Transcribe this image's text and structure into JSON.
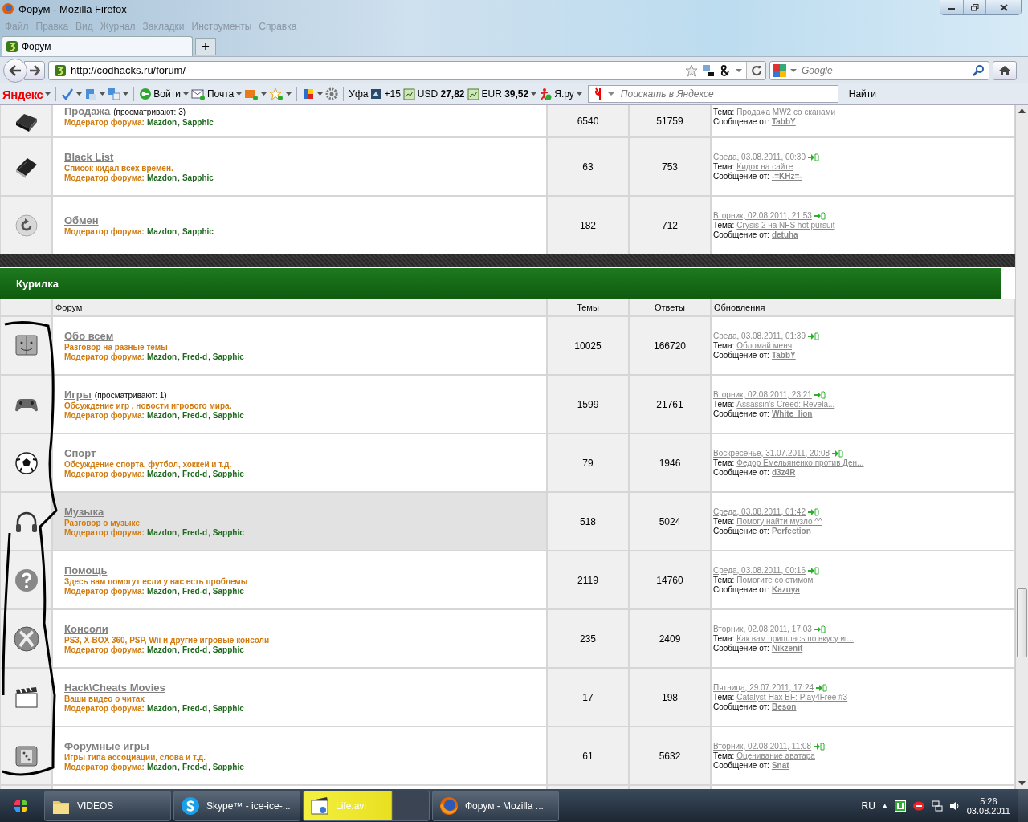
{
  "window": {
    "title": "Форум - Mozilla Firefox"
  },
  "menu": [
    "Файл",
    "Правка",
    "Вид",
    "Журнал",
    "Закладки",
    "Инструменты",
    "Справка"
  ],
  "tabs": [
    {
      "label": "Форум",
      "selected": true
    }
  ],
  "new_tab": "+",
  "address_bar": {
    "url": "http://codhacks.ru/forum/"
  },
  "search_bar": {
    "placeholder": "Google"
  },
  "yandex_toolbar": {
    "logo": "Яндекс",
    "login": "Войти",
    "mail": "Почта",
    "city": "Уфа",
    "temperature": "+15",
    "usd": "USD **27,82**",
    "eur": "EUR **39,52**",
    "yaru": "Я.ру",
    "search": {
      "placeholder": "Поискать в Яндексе"
    },
    "find_button": "Найти"
  },
  "upper_forums": [
    {
      "title": "Продажа",
      "viewers": "(просматривают: 3)",
      "moderator_label": "Модератор форума:",
      "moderators": [
        "Mazdon",
        "Sapphic"
      ],
      "separator": ",",
      "topics": "6540",
      "replies": "51759",
      "last": {
        "topic_label": "Тема:",
        "topic": "Продажа MW2 со сканами",
        "author_label": "Сообщение от:",
        "author": "TabbY"
      },
      "highlighted": false
    },
    {
      "title": "Black List",
      "description": "Список кидал всех времен.",
      "moderator_label": "Модератор форума:",
      "moderators": [
        "Mazdon",
        "Sapphic"
      ],
      "separator": ",",
      "topics": "63",
      "replies": "753",
      "last": {
        "date": "Среда, 03.08.2011, 00:30",
        "topic_label": "Тема:",
        "topic": "Кидок на сайте",
        "author_label": "Сообщение от:",
        "author": "-=KHz=-"
      },
      "highlighted": false
    },
    {
      "title": "Обмен",
      "moderator_label": "Модератор форума:",
      "moderators": [
        "Mazdon",
        "Sapphic"
      ],
      "separator": ",",
      "topics": "182",
      "replies": "712",
      "last": {
        "date": "Вторник, 02.08.2011, 21:53",
        "topic_label": "Тема:",
        "topic": "Crysis 2 на NFS hot pursuit",
        "author_label": "Сообщение от:",
        "author": "detuha"
      },
      "highlighted": false
    }
  ],
  "category": {
    "title": "Курилка",
    "columns": [
      "Форум",
      "Темы",
      "Ответы",
      "Обновления"
    ],
    "forums": [
      {
        "title": "Обо всем",
        "description": "Разговор на разные темы",
        "moderator_label": "Модератор форума:",
        "moderators": [
          "Mazdon",
          "Fred-d",
          "Sapphic"
        ],
        "separator": ",",
        "topics": "10025",
        "replies": "166720",
        "last": {
          "date": "Среда, 03.08.2011, 01:39",
          "topic_label": "Тема:",
          "topic": "Обломай меня",
          "author_label": "Сообщение от:",
          "author": "TabbY"
        },
        "highlighted": false
      },
      {
        "title": "Игры",
        "viewers": "(просматривают: 1)",
        "description": "Обсуждение игр , новости игрового мира.",
        "moderator_label": "Модератор форума:",
        "moderators": [
          "Mazdon",
          "Fred-d",
          "Sapphic"
        ],
        "separator": ",",
        "topics": "1599",
        "replies": "21761",
        "last": {
          "date": "Вторник, 02.08.2011, 23:21",
          "topic_label": "Тема:",
          "topic": "Assassin's Creed: Revela...",
          "author_label": "Сообщение от:",
          "author": "White_lion"
        },
        "highlighted": false
      },
      {
        "title": "Спорт",
        "description": "Обсуждение спорта, футбол, хоккей и т.д.",
        "moderator_label": "Модератор форума:",
        "moderators": [
          "Mazdon",
          "Fred-d",
          "Sapphic"
        ],
        "separator": ",",
        "topics": "79",
        "replies": "1946",
        "last": {
          "date": "Воскресенье, 31.07.2011, 20:08",
          "topic_label": "Тема:",
          "topic": "Федор Емельяненко против Ден...",
          "author_label": "Сообщение от:",
          "author": "d3z4R"
        },
        "highlighted": false
      },
      {
        "title": "Музыка",
        "description": "Разговор о музыке",
        "moderator_label": "Модератор форума:",
        "moderators": [
          "Mazdon",
          "Fred-d",
          "Sapphic"
        ],
        "separator": ",",
        "topics": "518",
        "replies": "5024",
        "last": {
          "date": "Среда, 03.08.2011, 01:42",
          "topic_label": "Тема:",
          "topic": "Помогу найти музло ^^",
          "author_label": "Сообщение от:",
          "author": "Perfection"
        },
        "highlighted": true
      },
      {
        "title": "Помощь",
        "description": "Здесь вам помогут если у вас есть проблемы",
        "moderator_label": "Модератор форума:",
        "moderators": [
          "Mazdon",
          "Fred-d",
          "Sapphic"
        ],
        "separator": ",",
        "topics": "2119",
        "replies": "14760",
        "last": {
          "date": "Среда, 03.08.2011, 00:16",
          "topic_label": "Тема:",
          "topic": "Помогите со стимом",
          "author_label": "Сообщение от:",
          "author": "Kazuya"
        },
        "highlighted": false
      },
      {
        "title": "Консоли",
        "description": "PS3, X-BOX 360, PSP, Wii и другие игровые консоли",
        "moderator_label": "Модератор форума:",
        "moderators": [
          "Mazdon",
          "Fred-d",
          "Sapphic"
        ],
        "separator": ",",
        "topics": "235",
        "replies": "2409",
        "last": {
          "date": "Вторник, 02.08.2011, 17:03",
          "topic_label": "Тема:",
          "topic": "Как вам пришлась по вкусу иг...",
          "author_label": "Сообщение от:",
          "author": "Nikzenit"
        },
        "highlighted": false
      },
      {
        "title": "Hack\\Cheats Movies",
        "description": "Ваши видео о читах",
        "moderator_label": "Модератор форума:",
        "moderators": [
          "Mazdon",
          "Fred-d",
          "Sapphic"
        ],
        "separator": ",",
        "topics": "17",
        "replies": "198",
        "last": {
          "date": "Пятница, 29.07.2011, 17:24",
          "topic_label": "Тема:",
          "topic": "Catalyst-Hax BF: Play4Free #3",
          "author_label": "Сообщение от:",
          "author": "Beson"
        },
        "highlighted": false
      },
      {
        "title": "Форумные игры",
        "description": "Игры типа ассоциации, слова и т.д.",
        "moderator_label": "Модератор форума:",
        "moderators": [
          "Mazdon",
          "Fred-d",
          "Sapphic"
        ],
        "separator": ",",
        "topics": "61",
        "replies": "5632",
        "last": {
          "date": "Вторник, 02.08.2011, 11:08",
          "topic_label": "Тема:",
          "topic": "Оценивание аватара",
          "author_label": "Сообщение от:",
          "author": "Snat"
        },
        "highlighted": false
      }
    ]
  },
  "taskbar": {
    "buttons": [
      {
        "label": "VIDEOS",
        "flashing": false
      },
      {
        "label": "Skype™ - ice-ice-...",
        "flashing": false
      },
      {
        "label": "Life.avi",
        "flashing": true
      },
      {
        "label": "Форум - Mozilla ...",
        "flashing": false
      }
    ],
    "language": "RU",
    "tray_arrow": "▲",
    "time": "5:26",
    "date": "03.08.2011"
  }
}
